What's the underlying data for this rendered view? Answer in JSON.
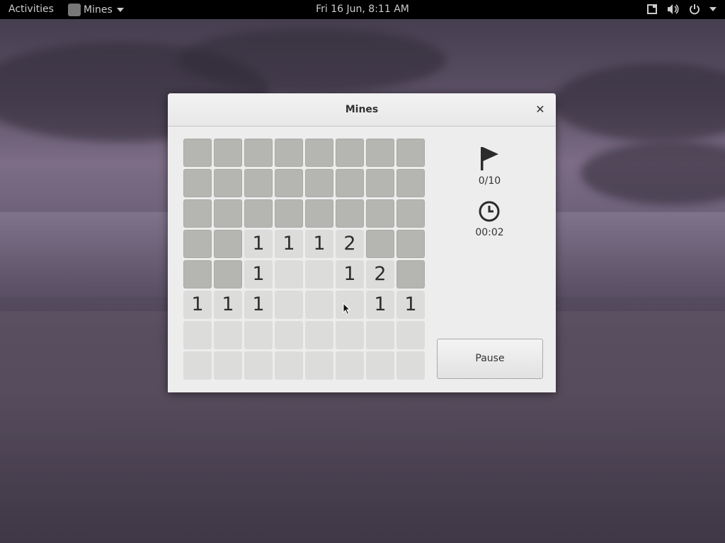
{
  "topbar": {
    "activities": "Activities",
    "app_name": "Mines",
    "clock": "Fri 16 Jun,  8:11 AM",
    "tray_icons": [
      "screen-icon",
      "volume-icon",
      "power-icon"
    ]
  },
  "window": {
    "title": "Mines",
    "flags": "0/10",
    "time": "00:02",
    "pause_label": "Pause"
  },
  "board": {
    "rows": [
      [
        "#",
        "#",
        "#",
        "#",
        "#",
        "#",
        "#",
        "#"
      ],
      [
        "#",
        "#",
        "#",
        "#",
        "#",
        "#",
        "#",
        "#"
      ],
      [
        "#",
        "#",
        "#",
        "#",
        "#",
        "#",
        "#",
        "#"
      ],
      [
        "#",
        "#",
        "1",
        "1",
        "1",
        "2",
        "#",
        "#"
      ],
      [
        "#",
        "#",
        "1",
        "",
        "",
        "1",
        "2",
        "#"
      ],
      [
        "1",
        "1",
        "1",
        "",
        "",
        "",
        "1",
        "1"
      ],
      [
        "",
        "",
        "",
        "",
        "",
        "",
        "",
        ""
      ],
      [
        "",
        "",
        "",
        "",
        "",
        "",
        "",
        ""
      ]
    ]
  },
  "colors": {
    "covered": "#b5b5b2",
    "open": "#dcdcdb",
    "number": "#2e2e2e"
  }
}
